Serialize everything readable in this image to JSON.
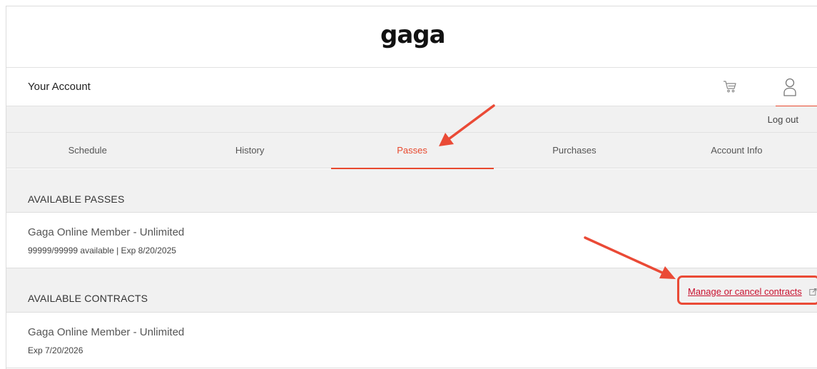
{
  "brand": {
    "logo_text": "gaga"
  },
  "header": {
    "title": "Your Account",
    "cart_icon": "cart-icon",
    "user_icon": "user-icon"
  },
  "account": {
    "logout_label": "Log out"
  },
  "tabs": [
    {
      "label": "Schedule",
      "active": false
    },
    {
      "label": "History",
      "active": false
    },
    {
      "label": "Passes",
      "active": true
    },
    {
      "label": "Purchases",
      "active": false
    },
    {
      "label": "Account Info",
      "active": false
    }
  ],
  "passes_section": {
    "title": "AVAILABLE PASSES",
    "items": [
      {
        "name": "Gaga Online Member - Unlimited",
        "detail": "99999/99999 available | Exp 8/20/2025"
      }
    ]
  },
  "contracts_section": {
    "title": "AVAILABLE CONTRACTS",
    "manage_link": "Manage or cancel contracts",
    "manage_icon": "external-link-icon",
    "items": [
      {
        "name": "Gaga Online Member - Unlimited",
        "detail": "Exp 7/20/2026"
      }
    ]
  },
  "colors": {
    "accent": "#e8492e",
    "link": "#c8102e",
    "annotation": "#ea4a36",
    "panel": "#f1f1f1"
  }
}
